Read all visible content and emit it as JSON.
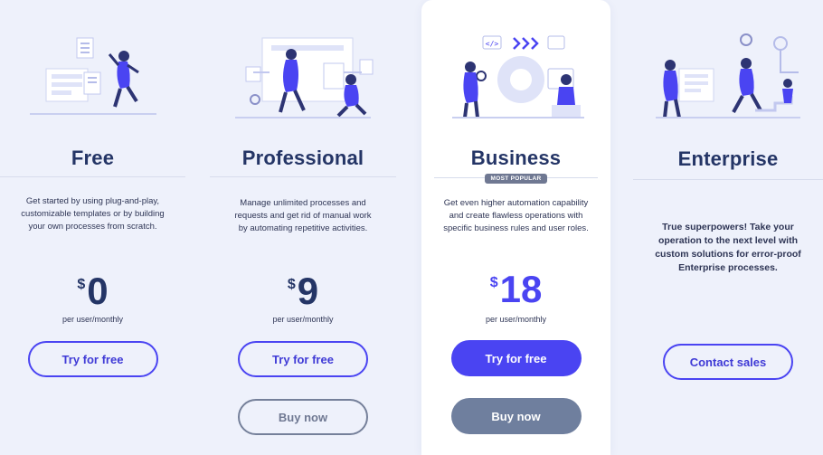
{
  "plans": [
    {
      "name": "Free",
      "description": "Get started by using plug-and-play, customizable templates or by building your own processes from scratch.",
      "currency": "$",
      "price": "0",
      "period": "per user/monthly",
      "primary_button": "Try for free"
    },
    {
      "name": "Professional",
      "description": "Manage unlimited processes and requests and get rid of manual work by automating repetitive activities.",
      "currency": "$",
      "price": "9",
      "period": "per user/monthly",
      "primary_button": "Try for free",
      "secondary_button": "Buy now"
    },
    {
      "name": "Business",
      "badge": "MOST POPULAR",
      "description": "Get even higher automation capability and create flawless operations with specific business rules and user roles.",
      "currency": "$",
      "price": "18",
      "period": "per user/monthly",
      "primary_button": "Try for free",
      "secondary_button": "Buy now"
    },
    {
      "name": "Enterprise",
      "description": "True superpowers! Take your operation to the next level with custom solutions for error-proof Enterprise processes.",
      "primary_button": "Contact sales"
    }
  ],
  "colors": {
    "background": "#eef1fb",
    "accent": "#4a44f2",
    "heading": "#243566",
    "muted_button": "#6f7f9e"
  }
}
